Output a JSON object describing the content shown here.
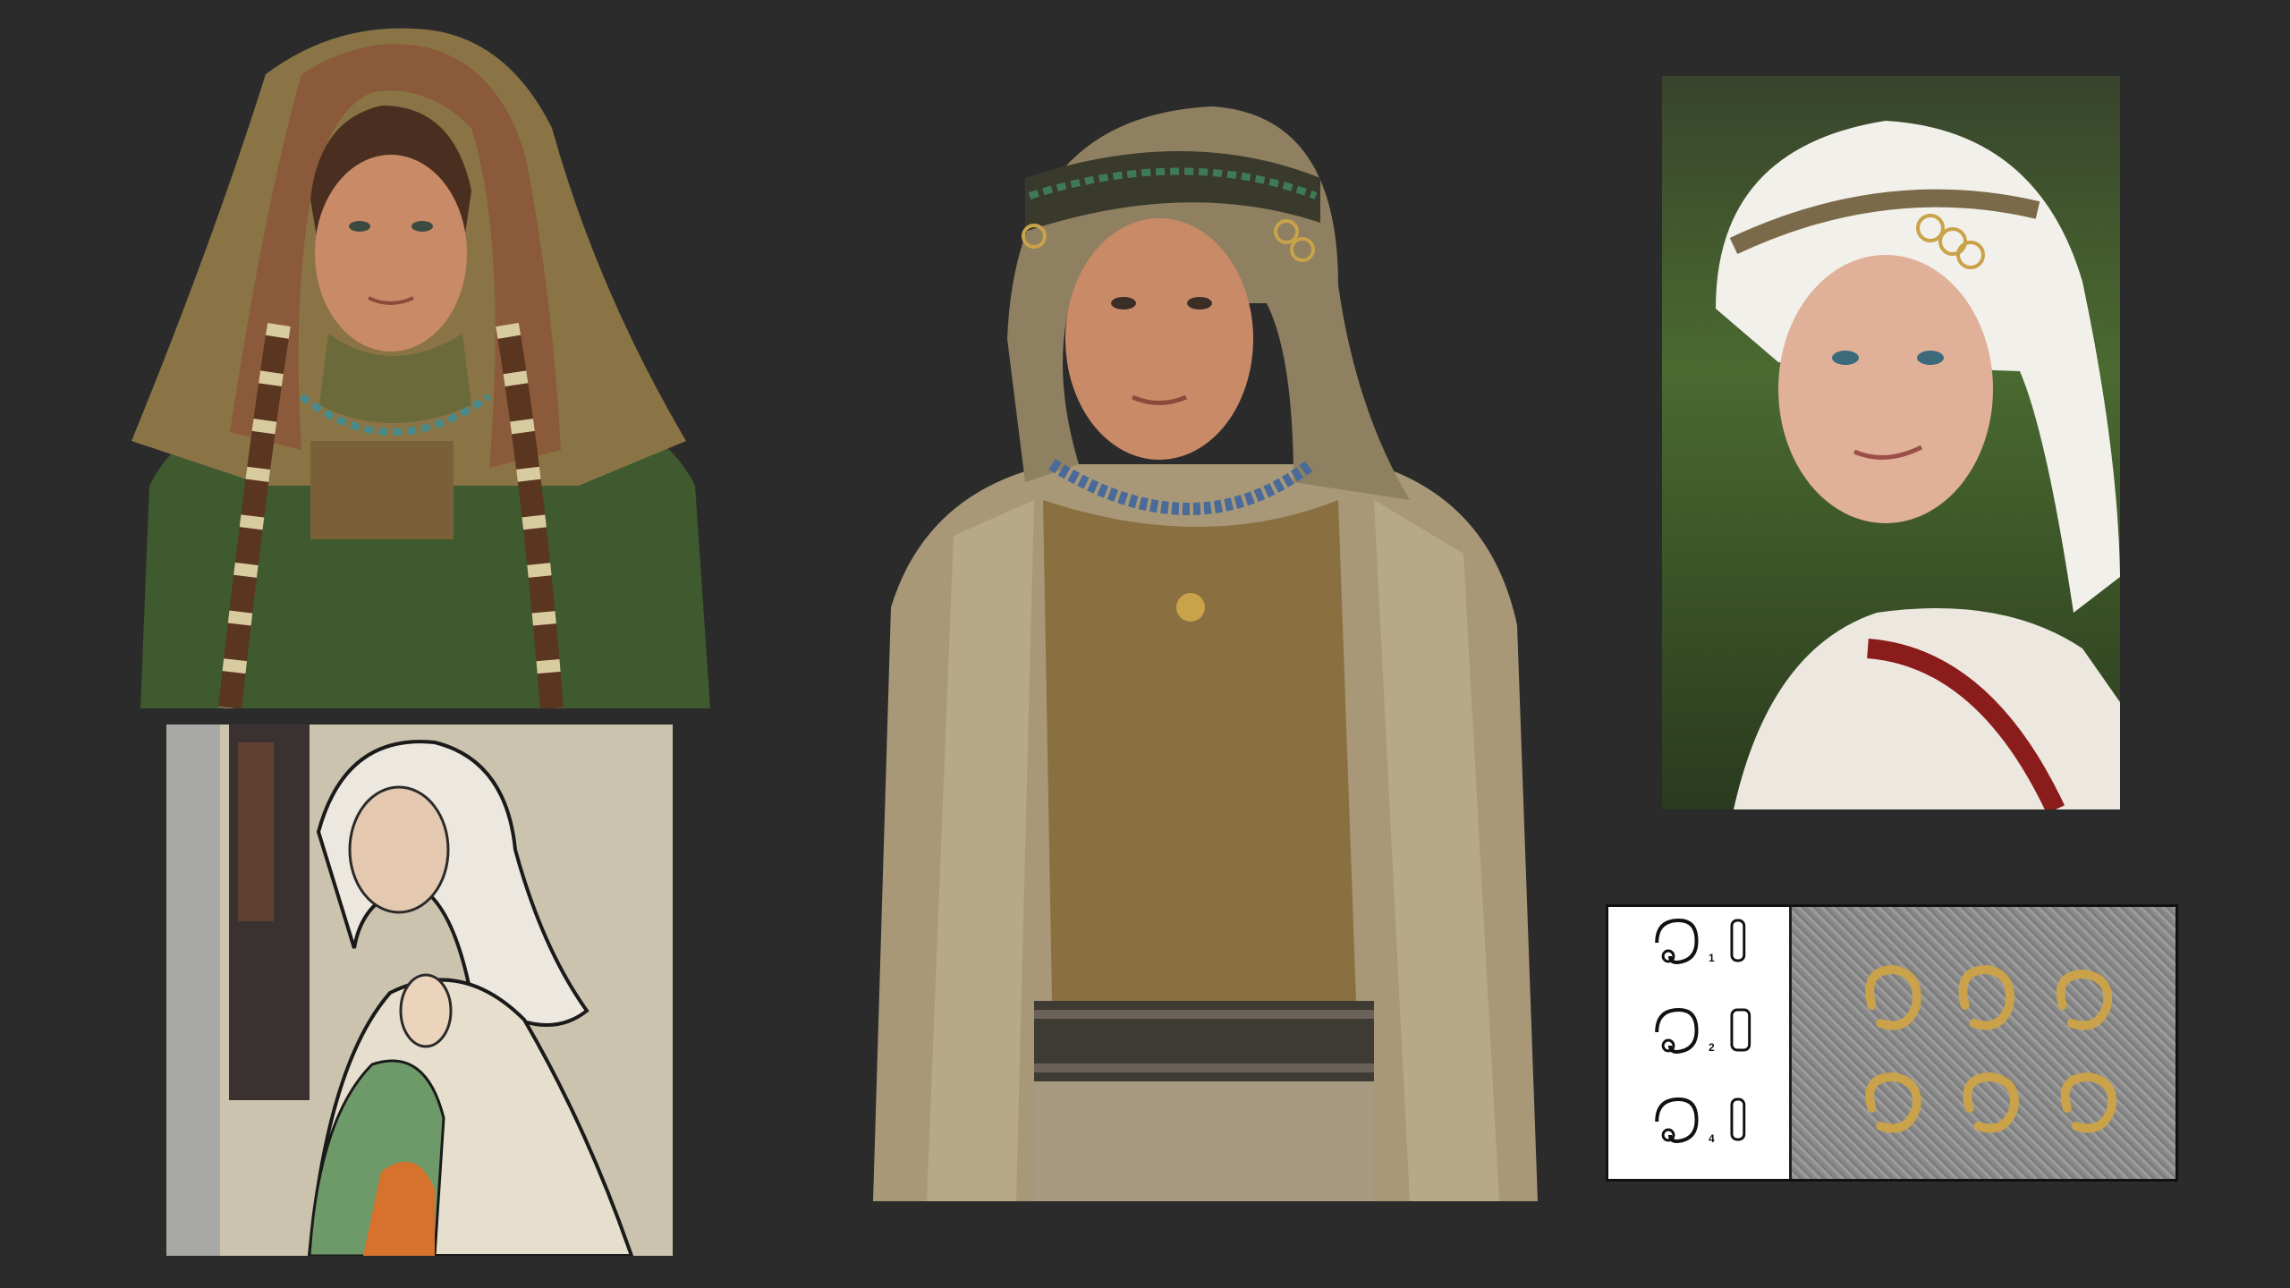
{
  "panels": [
    {
      "id": "render-hood",
      "subject": "3d-render-woman-fur-hood"
    },
    {
      "id": "manuscript",
      "subject": "medieval-manuscript-illustration"
    },
    {
      "id": "render-center",
      "subject": "3d-render-woman-headscarf-coat"
    },
    {
      "id": "photo",
      "subject": "reenactor-photo-white-headscarf"
    },
    {
      "id": "rings",
      "subject": "temple-rings-drawing-and-photo"
    }
  ],
  "rings_figure": {
    "labels": [
      "1",
      "2",
      "4"
    ]
  },
  "colors": {
    "background": "#2b2b2b",
    "green_dress": "#3f5a2e",
    "fur": "#8a5a3a",
    "hood": "#8a7445",
    "coat": "#a89878",
    "gold": "#c9a24a",
    "red_strap": "#8a1c1c"
  }
}
